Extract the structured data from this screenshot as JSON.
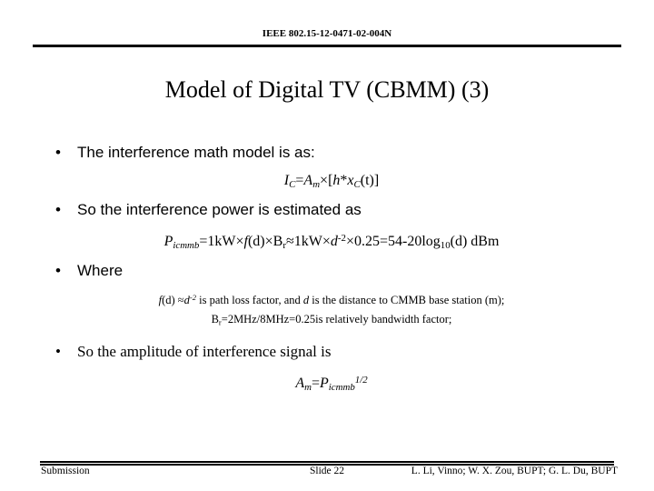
{
  "header": {
    "doc_id": "IEEE 802.15-12-0471-02-004N"
  },
  "title": "Model of Digital TV (CBMM) (3)",
  "bullets": {
    "b1": "The interference math model is as:",
    "b2": "So the interference power is estimated as",
    "b3": "Where",
    "b4": "So the amplitude of interference signal is",
    "marker": "•"
  },
  "equations": {
    "eq1": {
      "lhs_var": "I",
      "lhs_sub": "C",
      "eq_sign": "=",
      "rhs_var": "A",
      "rhs_sub": "m",
      "times": "×",
      "bracket_open": "[",
      "h": "h",
      "star": "*",
      "x": "x",
      "x_sub": "C",
      "t": "(t)",
      "bracket_close": "]",
      "plain": "I_C=A_m×[h*x_C(t)]"
    },
    "eq2": {
      "p_var": "P",
      "p_sub": "icmmb",
      "part1": "=1k",
      "w1": "W",
      "times1": "×",
      "f": "f",
      "d1": "(d)",
      "times2": "×",
      "b": "B",
      "b_sub": "r",
      "approx": "≈",
      "part2": "1k",
      "w2": "W",
      "times3": "×",
      "d2": "d",
      "d_exp": "-2",
      "times4": "×",
      "part3": "0.25=54-20log",
      "log_sub": "10",
      "d3": "(d)",
      "unit": "dBm",
      "plain": "P_icmmb=1kW×f(d)×B_r≈1kW×d^-2×0.25=54-20log10(d) dBm"
    },
    "eq3": {
      "a_var": "A",
      "a_sub": "m",
      "eq_sign": "=",
      "p_var": "P",
      "p_sub": "icmmb",
      "exp": "1/2",
      "plain": "A_m=P_icmmb^1/2"
    }
  },
  "notes": {
    "note1": {
      "f": "f",
      "d1": "(d)",
      "approx": " ≈",
      "d2": "d",
      "d_exp": "-2",
      "text_mid": " is path loss factor, and ",
      "d3": "d",
      "text_end": " is the distance to CMMB base station (m);",
      "plain": "f(d) ≈d-2 is path loss factor, and d is the distance to CMMB base station (m);"
    },
    "note2": {
      "b": "B",
      "b_sub": "r",
      "text": "=2MHz/8MHz=0.25is relatively bandwidth factor;",
      "plain": "Br=2MHz/8MHz=0.25is relatively bandwidth factor;"
    }
  },
  "footer": {
    "left": "Submission",
    "center": "Slide 22",
    "right": "L. Li, Vinno; W. X. Zou, BUPT; G. L. Du, BUPT"
  }
}
